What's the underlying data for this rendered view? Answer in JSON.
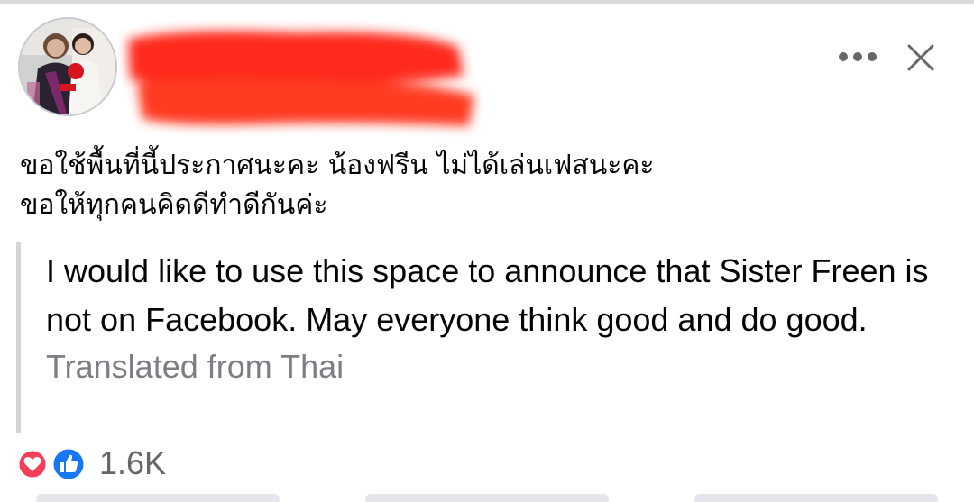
{
  "post": {
    "author_name_redacted": true,
    "body_lines": [
      "ขอใช้พื้นที่นี้ประกาศนะคะ น้องฟรีน ไม่ได้เล่นเฟสนะคะ",
      "ขอให้ทุกคนคิดดีทำดีกันค่ะ"
    ],
    "translation": "I would like to use this space to announce that Sister Freen is not on Facebook. May everyone think good and do good.",
    "translated_label": "Translated from Thai"
  },
  "header": {
    "more_icon": "more-horizontal-icon",
    "close_icon": "close-icon"
  },
  "reactions": {
    "icons": [
      "love-reaction-icon",
      "like-reaction-icon"
    ],
    "count": "1.6K"
  },
  "colors": {
    "redaction": "#ff2a1a",
    "love": "#f33e58",
    "like": "#1877f2",
    "quote_bar": "#d2d4d8",
    "secondary_text": "#7b7e83"
  }
}
